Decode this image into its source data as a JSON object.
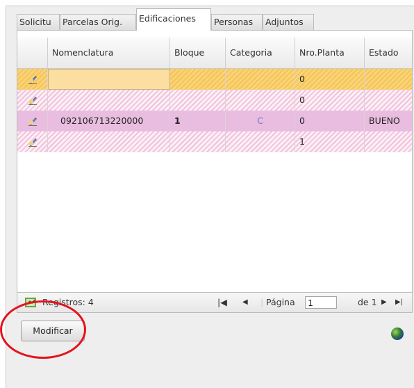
{
  "tabs": [
    {
      "label": "Solicitu"
    },
    {
      "label": "Parcelas Orig."
    },
    {
      "label": "Edificaciones",
      "active": true
    },
    {
      "label": "Personas"
    },
    {
      "label": "Adjuntos"
    }
  ],
  "grid": {
    "columns": [
      "",
      "Nomenclatura",
      "Bloque",
      "Categoria",
      "Nro.Planta",
      "Estado"
    ],
    "rows": [
      {
        "nomenclatura": "",
        "bloque": "",
        "categoria": "",
        "nro_planta": "0",
        "estado": "",
        "style": "selected",
        "row_icon": "edit-row-icon"
      },
      {
        "nomenclatura": "",
        "bloque": "",
        "categoria": "",
        "nro_planta": "0",
        "estado": "",
        "style": "striped",
        "row_icon": "edit-row-icon"
      },
      {
        "nomenclatura": "092106713220000",
        "bloque": "1",
        "categoria": "C",
        "nro_planta": "0",
        "estado": "BUENO",
        "style": "filled",
        "row_icon": "edit-row-icon"
      },
      {
        "nomenclatura": "",
        "bloque": "",
        "categoria": "",
        "nro_planta": "1",
        "estado": "",
        "style": "striped",
        "row_icon": "edit-row-icon"
      }
    ]
  },
  "pager": {
    "records_label": "Registros: 4",
    "first": "|◀",
    "prev": "◀",
    "page_label": "Página",
    "page_value": "1",
    "of_label": "de 1",
    "next": "▶",
    "last": "▶|"
  },
  "actions": {
    "modify_label": "Modificar"
  },
  "colors": {
    "selected_row": "#f6c75a",
    "filled_row": "#e8bde0",
    "annotation": "#e3141e"
  }
}
